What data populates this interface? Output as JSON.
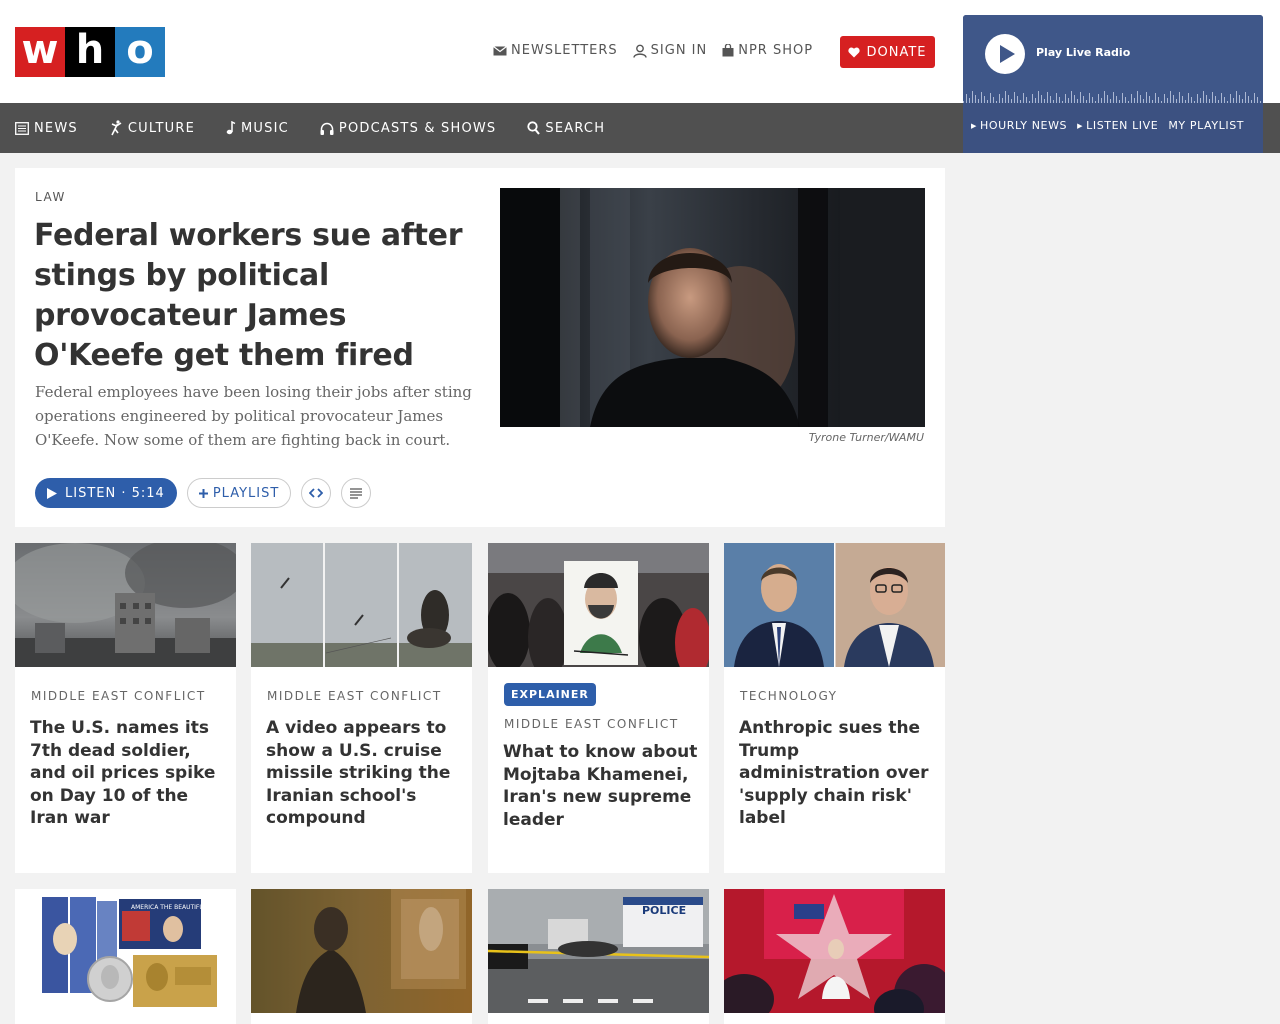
{
  "brand": {
    "letters": [
      "w",
      "h",
      "o"
    ]
  },
  "utility": {
    "newsletters": "NEWSLETTERS",
    "sign_in": "SIGN IN",
    "shop": "NPR SHOP",
    "donate": "DONATE"
  },
  "nav": {
    "news": "NEWS",
    "culture": "CULTURE",
    "music": "MUSIC",
    "podcasts": "PODCASTS & SHOWS",
    "search": "SEARCH"
  },
  "player": {
    "label": "Play Live Radio",
    "hourly": "HOURLY NEWS",
    "listen_live": "LISTEN LIVE",
    "my_playlist": "MY PLAYLIST"
  },
  "featured": {
    "slug": "LAW",
    "title": "Federal workers sue after stings by political provocateur James O'Keefe get them fired",
    "teaser": "Federal employees have been losing their jobs after sting operations engineered by political provocateur James O'Keefe. Now some of them are fighting back in court.",
    "credit": "Tyrone Turner/WAMU",
    "listen": "LISTEN · 5:14",
    "playlist": "PLAYLIST"
  },
  "cards": [
    {
      "slug": "MIDDLE EAST CONFLICT",
      "title": "The U.S. names its 7th dead soldier, and oil prices spike on Day 10 of the Iran war"
    },
    {
      "slug": "MIDDLE EAST CONFLICT",
      "title": "A video appears to show a U.S. cruise missile striking the Iranian school's compound"
    },
    {
      "badge": "EXPLAINER",
      "slug": "MIDDLE EAST CONFLICT",
      "title": "What to know about Mojtaba Khamenei, Iran's new supreme leader"
    },
    {
      "slug": "TECHNOLOGY",
      "title": "Anthropic sues the Trump administration over 'supply chain risk' label"
    }
  ],
  "image_text": {
    "police": "POLICE",
    "banner": "AMERICA THE BEAUTIFUL"
  },
  "colors": {
    "accent_red": "#d62021",
    "accent_blue": "#2e5eaa",
    "nav_bg": "#505050",
    "player_bg": "#3f5789"
  }
}
